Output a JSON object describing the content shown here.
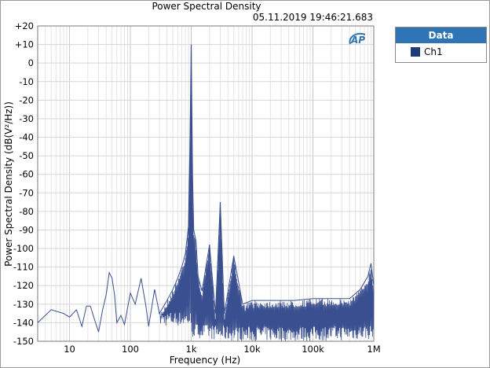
{
  "chart_data": {
    "type": "line",
    "title": "Power Spectral Density",
    "timestamp": "05.11.2019 19:46:21.683",
    "xlabel": "Frequency (Hz)",
    "ylabel": "Power Spectral Density (dB(V²/Hz))",
    "xscale": "log",
    "xlim": [
      3,
      1000000
    ],
    "ylim": [
      -150,
      20
    ],
    "x_ticks": [
      {
        "v": 10,
        "label": "10"
      },
      {
        "v": 100,
        "label": "100"
      },
      {
        "v": 1000,
        "label": "1k"
      },
      {
        "v": 10000,
        "label": "10k"
      },
      {
        "v": 100000,
        "label": "100k"
      },
      {
        "v": 1000000,
        "label": "1M"
      }
    ],
    "y_ticks": [
      {
        "v": 20,
        "label": "+20"
      },
      {
        "v": 10,
        "label": "+10"
      },
      {
        "v": 0,
        "label": "0"
      },
      {
        "v": -10,
        "label": "-10"
      },
      {
        "v": -20,
        "label": "-20"
      },
      {
        "v": -30,
        "label": "-30"
      },
      {
        "v": -40,
        "label": "-40"
      },
      {
        "v": -50,
        "label": "-50"
      },
      {
        "v": -60,
        "label": "-60"
      },
      {
        "v": -70,
        "label": "-70"
      },
      {
        "v": -80,
        "label": "-80"
      },
      {
        "v": -90,
        "label": "-90"
      },
      {
        "v": -100,
        "label": "-100"
      },
      {
        "v": -110,
        "label": "-110"
      },
      {
        "v": -120,
        "label": "-120"
      },
      {
        "v": -130,
        "label": "-130"
      },
      {
        "v": -140,
        "label": "-140"
      },
      {
        "v": -150,
        "label": "-150"
      }
    ],
    "grid": true,
    "legend": {
      "position": "right",
      "header": "Data"
    },
    "series": [
      {
        "name": "Ch1",
        "color": "#3a4f8f",
        "peaks": [
          {
            "x": 1000,
            "y": 10
          },
          {
            "x": 3000,
            "y": -75
          },
          {
            "x": 2000,
            "y": -98
          },
          {
            "x": 5000,
            "y": -104
          }
        ],
        "points": [
          [
            3,
            -140
          ],
          [
            5,
            -133
          ],
          [
            8,
            -135
          ],
          [
            10,
            -137
          ],
          [
            13,
            -133
          ],
          [
            16,
            -142
          ],
          [
            19,
            -131
          ],
          [
            22,
            -131
          ],
          [
            25,
            -137
          ],
          [
            30,
            -145
          ],
          [
            35,
            -133
          ],
          [
            40,
            -125
          ],
          [
            45,
            -113
          ],
          [
            50,
            -116
          ],
          [
            55,
            -125
          ],
          [
            60,
            -140
          ],
          [
            70,
            -136
          ],
          [
            80,
            -141
          ],
          [
            100,
            -124
          ],
          [
            120,
            -130
          ],
          [
            150,
            -116
          ],
          [
            180,
            -131
          ],
          [
            200,
            -142
          ],
          [
            250,
            -122
          ],
          [
            300,
            -135
          ],
          [
            400,
            -128
          ],
          [
            500,
            -122
          ],
          [
            600,
            -116
          ],
          [
            700,
            -110
          ],
          [
            800,
            -103
          ],
          [
            900,
            -88
          ],
          [
            950,
            -45
          ],
          [
            1000,
            10
          ],
          [
            1050,
            -60
          ],
          [
            1100,
            -90
          ],
          [
            1200,
            -96
          ],
          [
            1300,
            -115
          ],
          [
            1500,
            -123
          ],
          [
            2000,
            -98
          ],
          [
            2500,
            -135
          ],
          [
            3000,
            -75
          ],
          [
            3500,
            -135
          ],
          [
            5000,
            -104
          ],
          [
            7000,
            -130
          ],
          [
            10000,
            -128
          ],
          [
            20000,
            -128
          ],
          [
            50000,
            -128
          ],
          [
            100000,
            -127
          ],
          [
            200000,
            -127
          ],
          [
            400000,
            -127
          ],
          [
            600000,
            -122
          ],
          [
            800000,
            -115
          ],
          [
            900000,
            -108
          ],
          [
            1000000,
            -120
          ]
        ],
        "noise_floor": [
          [
            1000,
            -148
          ],
          [
            2000,
            -149
          ],
          [
            5000,
            -150
          ],
          [
            10000,
            -150
          ],
          [
            100000,
            -150
          ],
          [
            1000000,
            -149
          ]
        ]
      }
    ]
  },
  "chart_id_text": "AP"
}
